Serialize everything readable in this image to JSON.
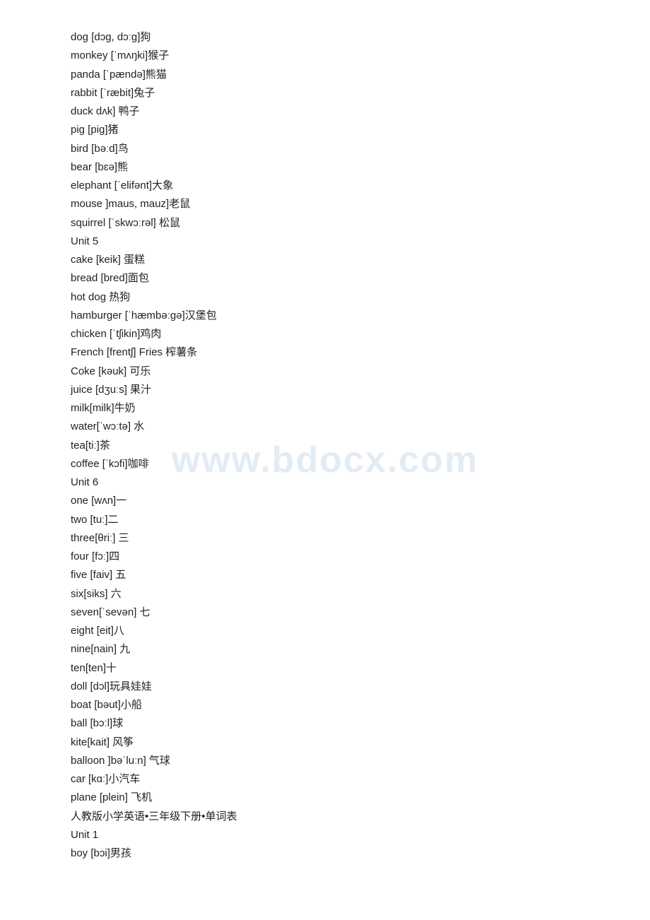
{
  "watermark": "www.bdocx.com",
  "lines": [
    "dog [dɔg, dɔːg]狗",
    "monkey [ˈmʌŋki]猴子",
    "panda [ˈpændə]熊猫",
    "rabbit [ˈræbit]兔子",
    "duck dʌk] 鸭子",
    "pig [pig]猪",
    "bird [bəːd]鸟",
    "bear [bɛə]熊",
    "elephant [ˈelifənt]大象",
    "mouse ]maus, mauz]老鼠",
    "squirrel [ˈskwɔːrəl] 松鼠",
    " Unit 5",
    "cake [keik] 蛋糕",
    "bread [bred]面包",
    "hot dog 热狗",
    "hamburger [ˈhæmbəːgə]汉堡包",
    "chicken [ˈtʃikin]鸡肉",
    "French [frentʃ]  Fries 榨薯条",
    "Coke [kəuk] 可乐",
    "juice [dʒuːs] 果汁",
    "milk[milk]牛奶",
    "water[ˈwɔːtə] 水",
    "tea[tiː]茶",
    "coffee [ˈkɔfi]咖啡",
    "Unit 6",
    "one [wʌn]一",
    "two [tuː]二",
    "three[θriː] 三",
    "four [fɔː]四",
    "five [faiv]  五",
    "six[siks] 六",
    "seven[ˈsevən] 七",
    "eight [eit]八",
    "nine[nain] 九",
    "ten[ten]十",
    "doll [dɔl]玩具娃娃",
    "boat [bəut]小船",
    "ball [bɔːl]球",
    "kite[kait]  风筝",
    "balloon ]bəˈluːn] 气球",
    "car [kɑː]小汽车",
    "plane [plein] 飞机",
    "人教版小学英语•三年级下册•单词表",
    "Unit 1",
    "boy [bɔi]男孩"
  ]
}
